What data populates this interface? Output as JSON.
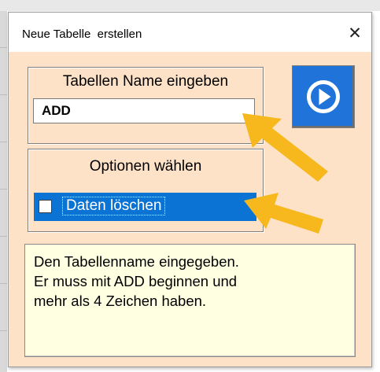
{
  "window": {
    "title": "Neue Tabelle  erstellen",
    "close_glyph": "✕"
  },
  "name_frame": {
    "label": "Tabellen Name eingeben",
    "value": "ADD"
  },
  "options_frame": {
    "label": "Optionen wählen",
    "checkbox_label": "Daten löschen",
    "checked": false
  },
  "run_button": {
    "icon": "play-circle-icon"
  },
  "info": {
    "lines": [
      "Den Tabellenname eingegeben.",
      "Er muss mit ADD beginnen und",
      "mehr als 4 Zeichen haben."
    ]
  },
  "annotations": {
    "arrow_color": "#f6b81c",
    "count": 2
  },
  "colors": {
    "dialog_bg": "#fde2c8",
    "accent_blue": "#0a73d4",
    "info_bg": "#ffffe1"
  }
}
